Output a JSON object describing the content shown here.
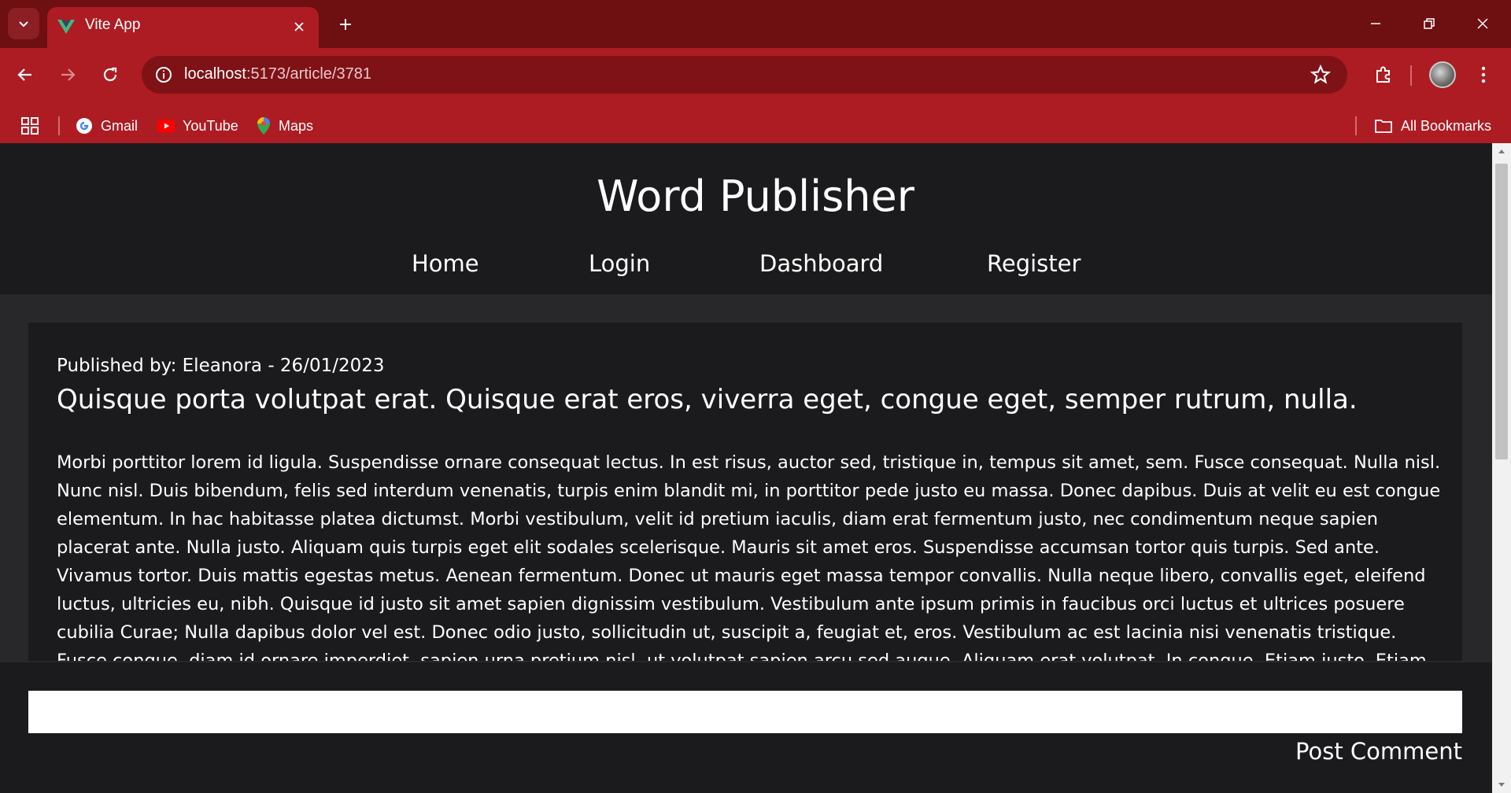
{
  "browser": {
    "tab_title": "Vite App",
    "url_host": "localhost",
    "url_path": ":5173/article/3781",
    "bookmarks": [
      {
        "label": "Gmail",
        "icon": "gmail-icon"
      },
      {
        "label": "YouTube",
        "icon": "youtube-icon"
      },
      {
        "label": "Maps",
        "icon": "maps-icon"
      }
    ],
    "all_bookmarks_label": "All Bookmarks",
    "colors": {
      "tabbar": "#6e0f12",
      "toolbar": "#ad1c22",
      "omnibox": "#7e1217"
    }
  },
  "site": {
    "title": "Word Publisher",
    "nav": [
      "Home",
      "Login",
      "Dashboard",
      "Register"
    ],
    "colors": {
      "header_bg": "#1b1b1d",
      "page_bg": "#28282a"
    }
  },
  "article": {
    "meta": "Published by: Eleanora - 26/01/2023",
    "headline": "Quisque porta volutpat erat. Quisque erat eros, viverra eget, congue eget, semper rutrum, nulla.",
    "body": "Morbi porttitor lorem id ligula. Suspendisse ornare consequat lectus. In est risus, auctor sed, tristique in, tempus sit amet, sem. Fusce consequat. Nulla nisl. Nunc nisl. Duis bibendum, felis sed interdum venenatis, turpis enim blandit mi, in porttitor pede justo eu massa. Donec dapibus. Duis at velit eu est congue elementum. In hac habitasse platea dictumst. Morbi vestibulum, velit id pretium iaculis, diam erat fermentum justo, nec condimentum neque sapien placerat ante. Nulla justo. Aliquam quis turpis eget elit sodales scelerisque. Mauris sit amet eros. Suspendisse accumsan tortor quis turpis. Sed ante. Vivamus tortor. Duis mattis egestas metus. Aenean fermentum. Donec ut mauris eget massa tempor convallis. Nulla neque libero, convallis eget, eleifend luctus, ultricies eu, nibh. Quisque id justo sit amet sapien dignissim vestibulum. Vestibulum ante ipsum primis in faucibus orci luctus et ultrices posuere cubilia Curae; Nulla dapibus dolor vel est. Donec odio justo, sollicitudin ut, suscipit a, feugiat et, eros. Vestibulum ac est lacinia nisi venenatis tristique. Fusce congue, diam id ornare imperdiet, sapien urna pretium nisl, ut volutpat sapien arcu sed augue. Aliquam erat volutpat. In congue. Etiam justo. Etiam pretium iaculis justo. In hac habitasse platea dictumst. Etiam faucibus cursus urna. Ut tellus."
  },
  "comment": {
    "input_value": "",
    "post_label": "Post Comment"
  }
}
